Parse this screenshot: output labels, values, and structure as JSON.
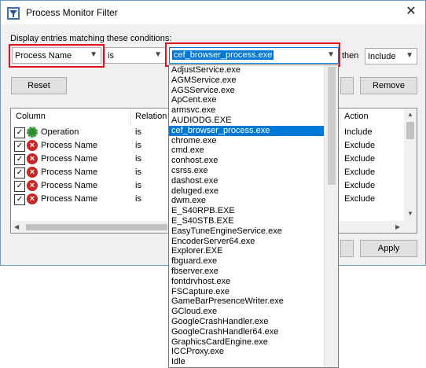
{
  "window": {
    "title": "Process Monitor Filter",
    "close_glyph": "✕",
    "prompt": "Display entries matching these conditions:"
  },
  "filter_row": {
    "column": "Process Name",
    "relation": "is",
    "value": "cef_browser_process.exe",
    "then_label": "then",
    "action": "Include"
  },
  "buttons": {
    "reset": "Reset",
    "remove": "Remove",
    "apply": "Apply"
  },
  "table": {
    "headers": [
      "Column",
      "Relation",
      "Action"
    ],
    "rows": [
      {
        "column": "Operation",
        "relation": "is",
        "action": "Include",
        "icon": "green-check-icon"
      },
      {
        "column": "Process Name",
        "relation": "is",
        "action": "Exclude",
        "icon": "red-x-icon"
      },
      {
        "column": "Process Name",
        "relation": "is",
        "action": "Exclude",
        "icon": "red-x-icon"
      },
      {
        "column": "Process Name",
        "relation": "is",
        "action": "Exclude",
        "icon": "red-x-icon"
      },
      {
        "column": "Process Name",
        "relation": "is",
        "action": "Exclude",
        "icon": "red-x-icon"
      },
      {
        "column": "Process Name",
        "relation": "is",
        "action": "Exclude",
        "icon": "red-x-icon"
      }
    ]
  },
  "dropdown": {
    "selected": "cef_browser_process.exe",
    "options": [
      "AdjustService.exe",
      "AGMService.exe",
      "AGSService.exe",
      "ApCent.exe",
      "armsvc.exe",
      "AUDIODG.EXE",
      "cef_browser_process.exe",
      "chrome.exe",
      "cmd.exe",
      "conhost.exe",
      "csrss.exe",
      "dashost.exe",
      "deluged.exe",
      "dwm.exe",
      "E_S40RPB.EXE",
      "E_S40STB.EXE",
      "EasyTuneEngineService.exe",
      "EncoderServer64.exe",
      "Explorer.EXE",
      "fbguard.exe",
      "fbserver.exe",
      "fontdrvhost.exe",
      "FSCapture.exe",
      "GameBarPresenceWriter.exe",
      "GCloud.exe",
      "GoogleCrashHandler.exe",
      "GoogleCrashHandler64.exe",
      "GraphicsCardEngine.exe",
      "ICCProxy.exe",
      "Idle"
    ]
  },
  "colors": {
    "highlight": "#0078d7",
    "annotation_red": "#e0141e",
    "exclude_icon": "#c62828",
    "include_icon": "#2e8b2e"
  }
}
